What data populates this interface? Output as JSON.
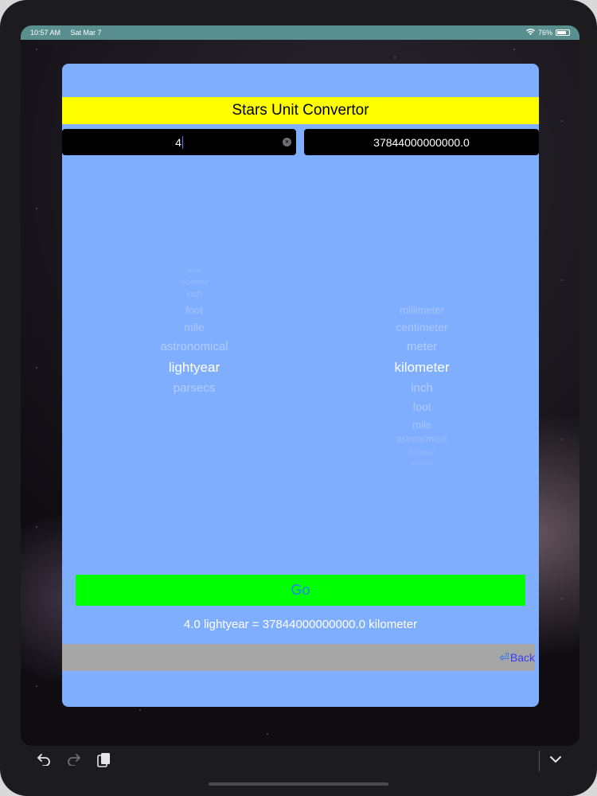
{
  "status": {
    "time": "10:57 AM",
    "date": "Sat Mar 7",
    "battery": "76%",
    "battery_level": 0.76
  },
  "app": {
    "title": "Stars Unit Convertor",
    "input_value": "4",
    "output_value": "37844000000000.0",
    "from_units": [
      "meter",
      "kilometer",
      "inch",
      "foot",
      "mile",
      "astronomical",
      "lightyear",
      "parsecs"
    ],
    "from_selected": "lightyear",
    "to_units": [
      "millimeter",
      "centimeter",
      "meter",
      "kilometer",
      "inch",
      "foot",
      "mile",
      "astronomical",
      "lightyear",
      "parsecs"
    ],
    "to_selected": "kilometer",
    "go_label": "Go",
    "result_text": "4.0 lightyear = 37844000000000.0 kilometer",
    "back_label": "Back"
  },
  "colors": {
    "card": "#80aeff",
    "title_bar": "#ffff00",
    "go_button": "#00ff00",
    "back_bar": "#a6a6a6",
    "link": "#2a7dff"
  },
  "icons": {
    "clear": "clear-icon",
    "back": "return-arrow-icon",
    "undo": "undo-icon",
    "redo": "redo-icon",
    "clipboard": "clipboard-icon",
    "keyboard_dismiss": "chevron-down-icon"
  }
}
